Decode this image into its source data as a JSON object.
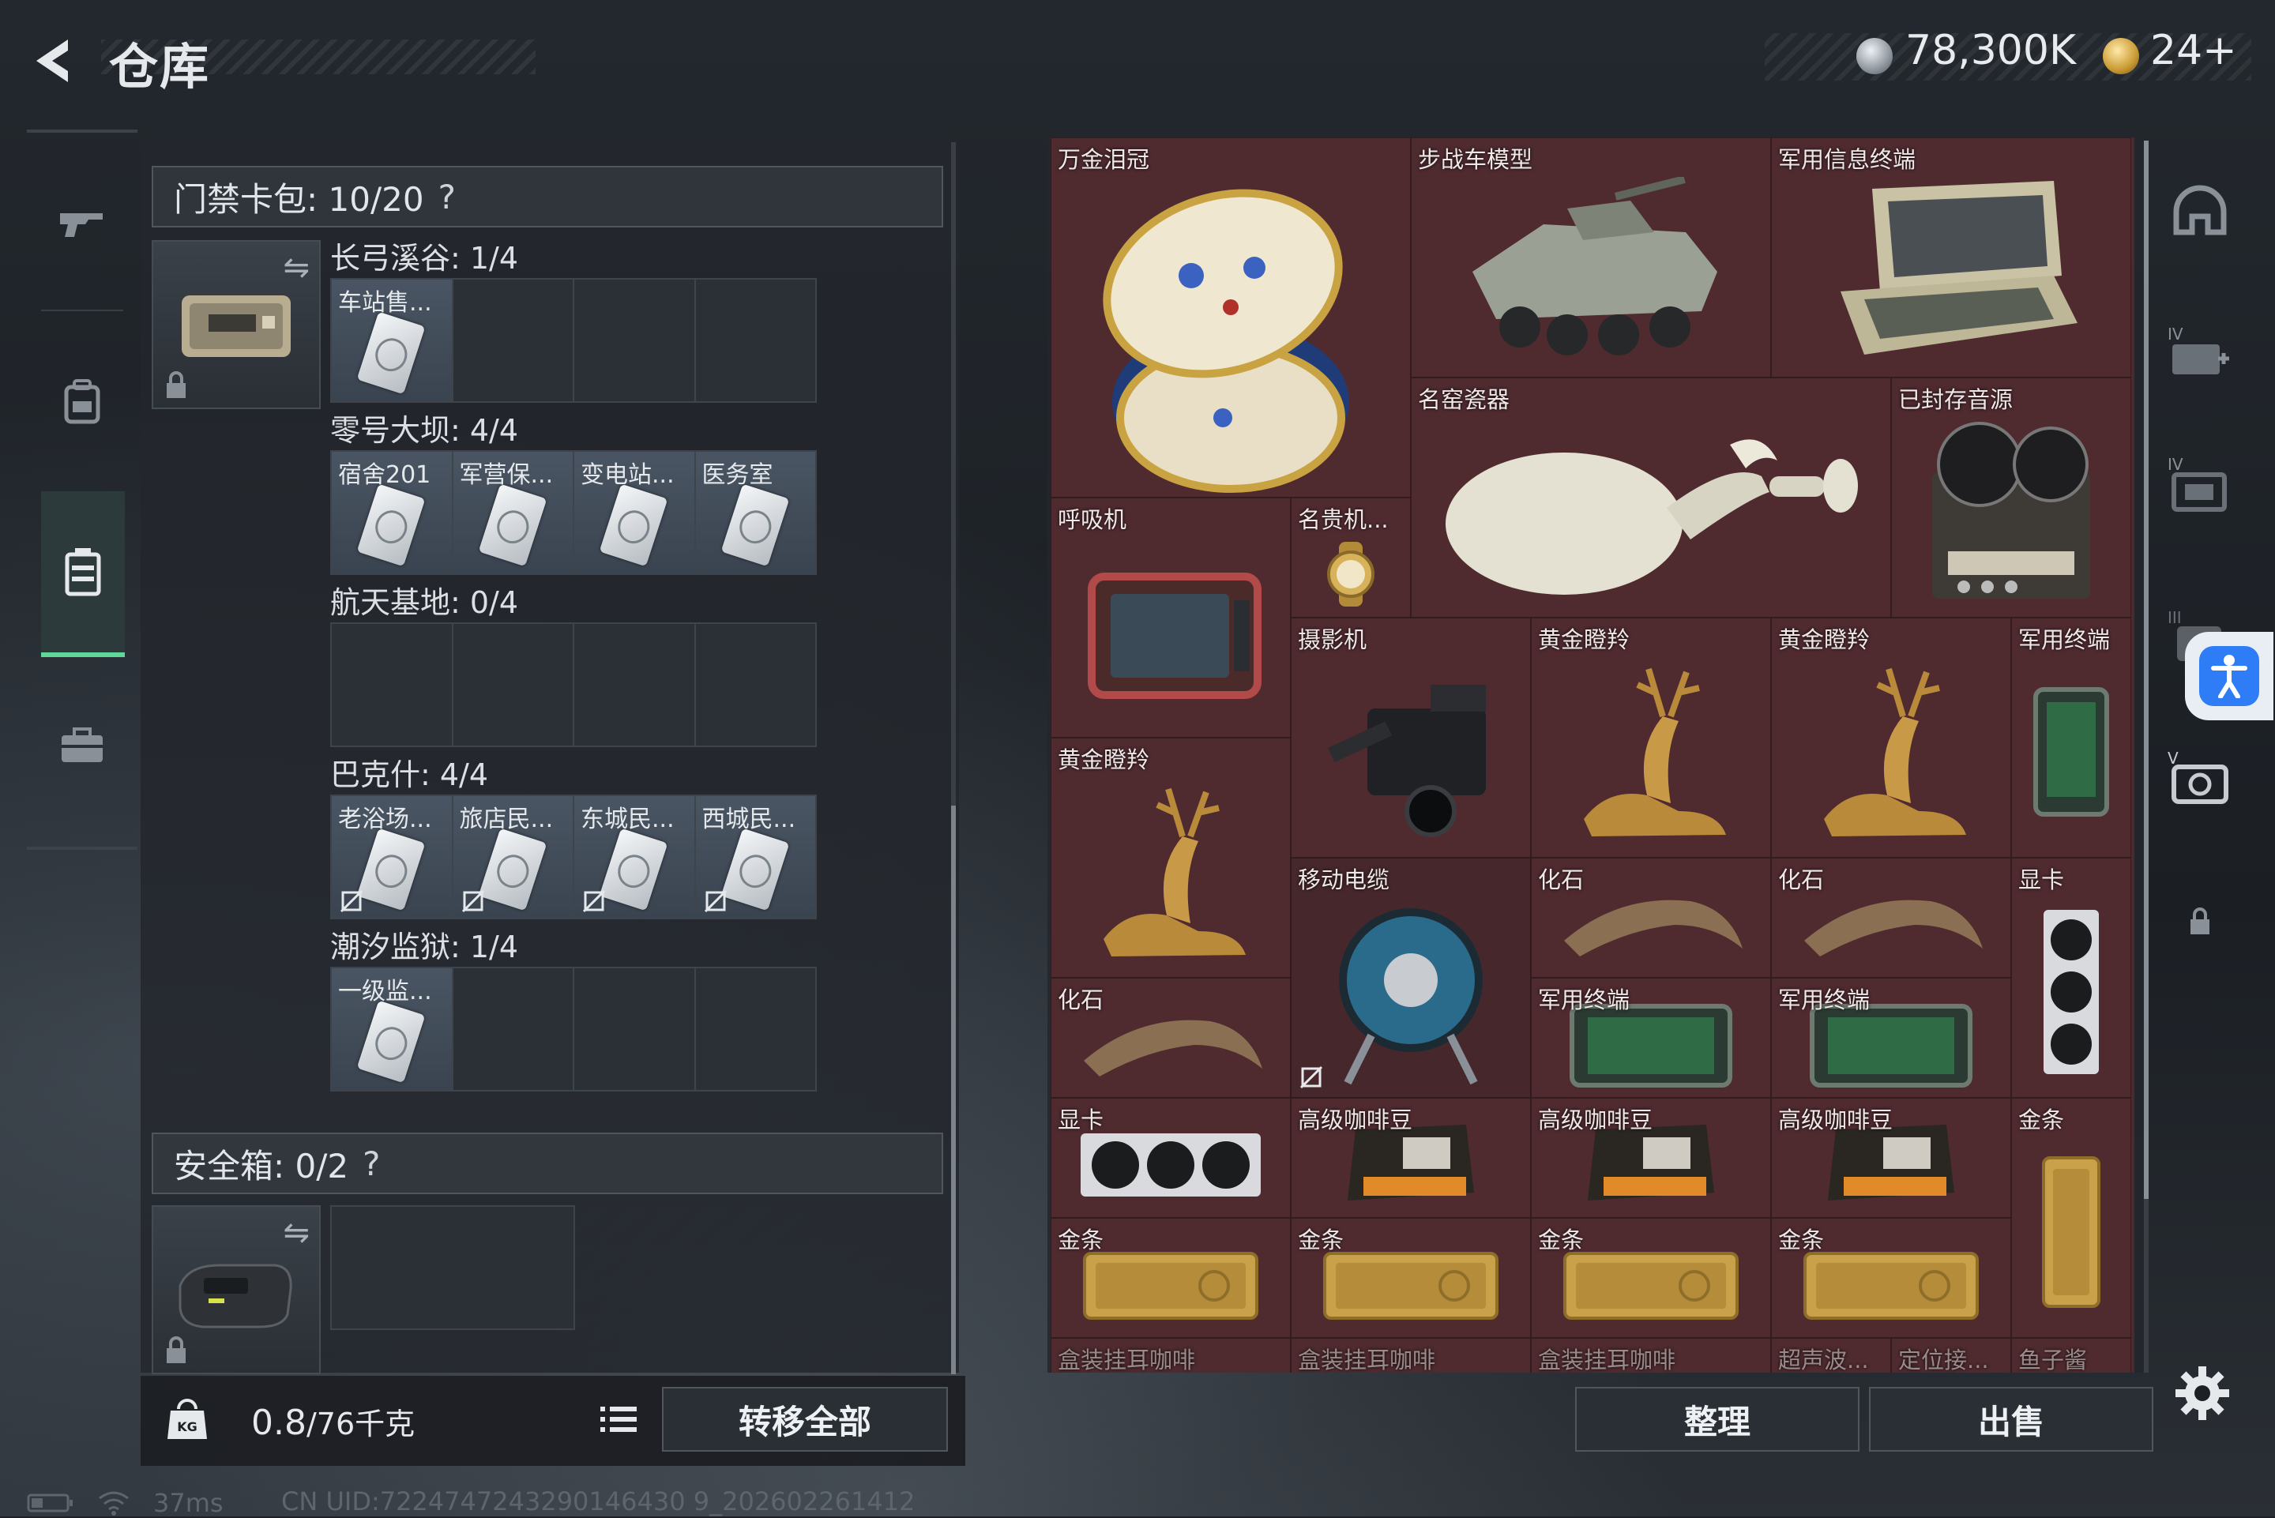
{
  "header": {
    "title": "仓库",
    "currency_main": "78,300K",
    "currency_secondary": "24+"
  },
  "nav": {
    "items": [
      "weapon-icon",
      "backpack-icon",
      "container-icon",
      "briefcase-icon"
    ],
    "active": "container-icon"
  },
  "keycard_pack": {
    "label": "门禁卡包:",
    "count": "10/20",
    "help": "?"
  },
  "keycard_groups": [
    {
      "name": "长弓溪谷: 1/4",
      "slots": [
        "车站售...",
        "",
        "",
        ""
      ]
    },
    {
      "name": "零号大坝: 4/4",
      "slots": [
        "宿舍201",
        "军营保...",
        "变电站...",
        "医务室"
      ]
    },
    {
      "name": "航天基地: 0/4",
      "slots": [
        "",
        "",
        "",
        ""
      ]
    },
    {
      "name": "巴克什: 4/4",
      "slots": [
        "老浴场...",
        "旅店民...",
        "东城民...",
        "西城民..."
      ]
    },
    {
      "name": "潮汐监狱: 1/4",
      "slots": [
        "一级监...",
        "",
        "",
        ""
      ]
    }
  ],
  "safe_box": {
    "label": "安全箱:",
    "count": "0/2",
    "help": "?"
  },
  "footer_left": {
    "weight_value": "0.8",
    "weight_total": "/76千克",
    "kg_badge": "KG",
    "transfer_all": "转移全部"
  },
  "stash_items": {
    "crown": "万金泪冠",
    "ifv_model": "步战车模型",
    "mil_info_terminal": "军用信息终端",
    "kiln_porcelain": "名窑瓷器",
    "sealed_audio": "已封存音源",
    "ventilator": "呼吸机",
    "luxury_watch": "名贵机...",
    "camera": "摄影机",
    "golden_deer_1": "黄金瞪羚",
    "golden_deer_2": "黄金瞪羚",
    "mil_terminal_small": "军用终端",
    "golden_deer_3": "黄金瞪羚",
    "cable_reel": "移动电缆",
    "fossil_1": "化石",
    "fossil_2": "化石",
    "gpu_vertical": "显卡",
    "fossil_3": "化石",
    "mil_terminal_1": "军用终端",
    "mil_terminal_2": "军用终端",
    "gpu_horizontal": "显卡",
    "coffee_1": "高级咖啡豆",
    "coffee_2": "高级咖啡豆",
    "coffee_3": "高级咖啡豆",
    "gold_bar_vertical": "金条",
    "gold_bar_1": "金条",
    "gold_bar_2": "金条",
    "gold_bar_3": "金条",
    "gold_bar_4": "金条",
    "partial_1": "盒装挂耳咖啡",
    "partial_2": "盒装挂耳咖啡",
    "partial_3": "盒装挂耳咖啡",
    "partial_4": "超声波...",
    "partial_5": "定位接...",
    "partial_6": "鱼子酱"
  },
  "footer_right": {
    "sort": "整理",
    "sell": "出售"
  },
  "right_rail": [
    "helmet-icon",
    "medkit-level-icon",
    "ammo-box-icon",
    "armor-level-icon",
    "camera-item-icon",
    "lock-icon"
  ],
  "status": {
    "latency": "37ms",
    "uid": "CN UID:7224747243290146430 9_202602261412"
  },
  "colors": {
    "accent_green": "#5fd89a",
    "stash_bg": "#4f2b30",
    "a11y_blue": "#2f7df6"
  }
}
